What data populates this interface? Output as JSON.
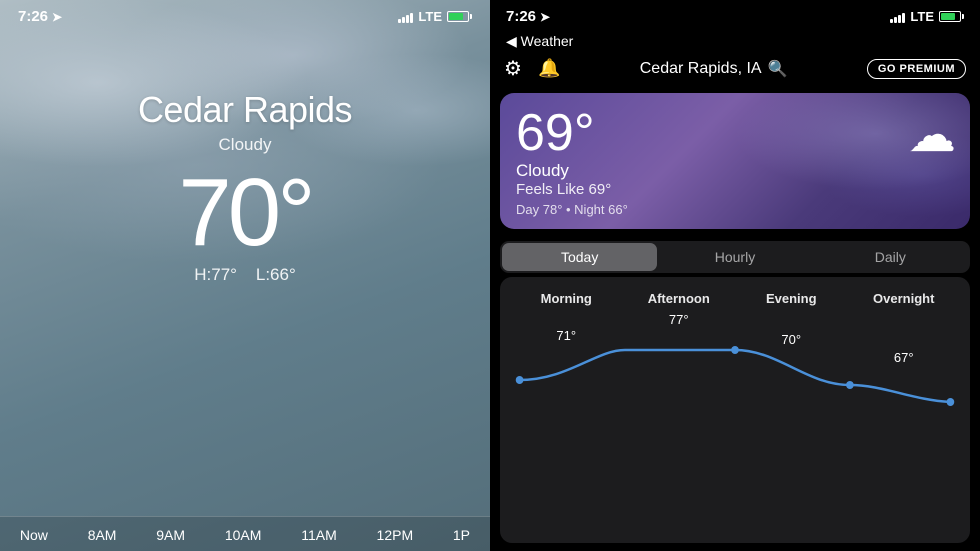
{
  "left": {
    "status": {
      "time": "7:26",
      "location_icon": "▶",
      "signal": "▋▋▋",
      "lte": "LTE",
      "battery": "🔋"
    },
    "city": "Cedar Rapids",
    "condition": "Cloudy",
    "temperature": "70°",
    "hi": "H:77°",
    "lo": "L:66°",
    "hourly": [
      "Now",
      "8AM",
      "9AM",
      "10AM",
      "11AM",
      "12PM",
      "1P"
    ]
  },
  "right": {
    "status": {
      "time": "7:26",
      "lte": "LTE"
    },
    "back_label": "◀ Weather",
    "settings_icon": "⚙",
    "bell_icon": "🔔",
    "city": "Cedar Rapids, IA",
    "search_icon": "🔍",
    "premium_label": "GO PREMIUM",
    "card": {
      "temperature": "69°",
      "condition": "Cloudy",
      "feels_like": "Feels Like 69°",
      "day_night": "Day 78° • Night 66°",
      "cloud_icon": "☁"
    },
    "tabs": [
      "Today",
      "Hourly",
      "Daily"
    ],
    "active_tab": 0,
    "forecast": {
      "periods": [
        "Morning",
        "Afternoon",
        "Evening",
        "Overnight"
      ],
      "temps": [
        "71°",
        "77°",
        "70°",
        "67°"
      ],
      "temp_positions": [
        "low",
        "peak",
        "mid",
        "end"
      ]
    }
  }
}
